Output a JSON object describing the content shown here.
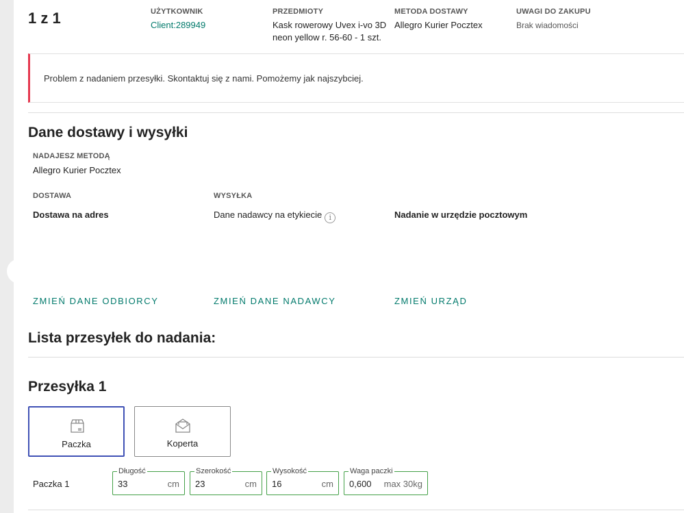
{
  "order": {
    "counter": "1 z 1"
  },
  "summary": {
    "user_label": "UŻYTKOWNIK",
    "user_value": "Client:289949",
    "items_label": "PRZEDMIOTY",
    "items_line1": "Kask rowerowy Uvex i-vo 3D",
    "items_line2": "neon yellow r. 56-60 - 1 szt.",
    "method_label": "METODA DOSTAWY",
    "method_value": "Allegro Kurier Pocztex",
    "notes_label": "UWAGI DO ZAKUPU",
    "notes_value": "Brak wiadomości"
  },
  "alert": {
    "text": "Problem z nadaniem przesyłki. Skontaktuj się z nami. Pomożemy jak najszybciej.",
    "accent": "#e53950"
  },
  "shipping": {
    "title": "Dane dostawy i wysyłki",
    "method_label": "NADAJESZ METODĄ",
    "method_value": "Allegro Kurier Pocztex",
    "delivery_label": "DOSTAWA",
    "delivery_value": "Dostawa na adres",
    "dispatch_label": "WYSYŁKA",
    "dispatch_value": "Dane nadawcy na etykiecie",
    "post_value": "Nadanie w urzędzie pocztowym",
    "change_recipient": "ZMIEŃ DANE ODBIORCY",
    "change_sender": "ZMIEŃ DANE NADAWCY",
    "change_office": "ZMIEŃ URZĄD",
    "link_color": "#00796b"
  },
  "parcels": {
    "list_title": "Lista przesyłek do nadania:",
    "parcel_title": "Przesyłka 1",
    "types": [
      {
        "label": "Paczka",
        "icon": "box-icon",
        "selected": true
      },
      {
        "label": "Koperta",
        "icon": "envelope-icon",
        "selected": false
      }
    ],
    "row_label": "Paczka 1",
    "fields": {
      "length": {
        "label": "Długość",
        "value": "33",
        "unit": "cm"
      },
      "width": {
        "label": "Szerokość",
        "value": "23",
        "unit": "cm"
      },
      "height": {
        "label": "Wysokość",
        "value": "16",
        "unit": "cm"
      },
      "weight": {
        "label": "Waga paczki",
        "value": "0,600",
        "unit": "max 30kg"
      }
    },
    "valid_color": "#43a047",
    "selected_color": "#3f51b5"
  }
}
